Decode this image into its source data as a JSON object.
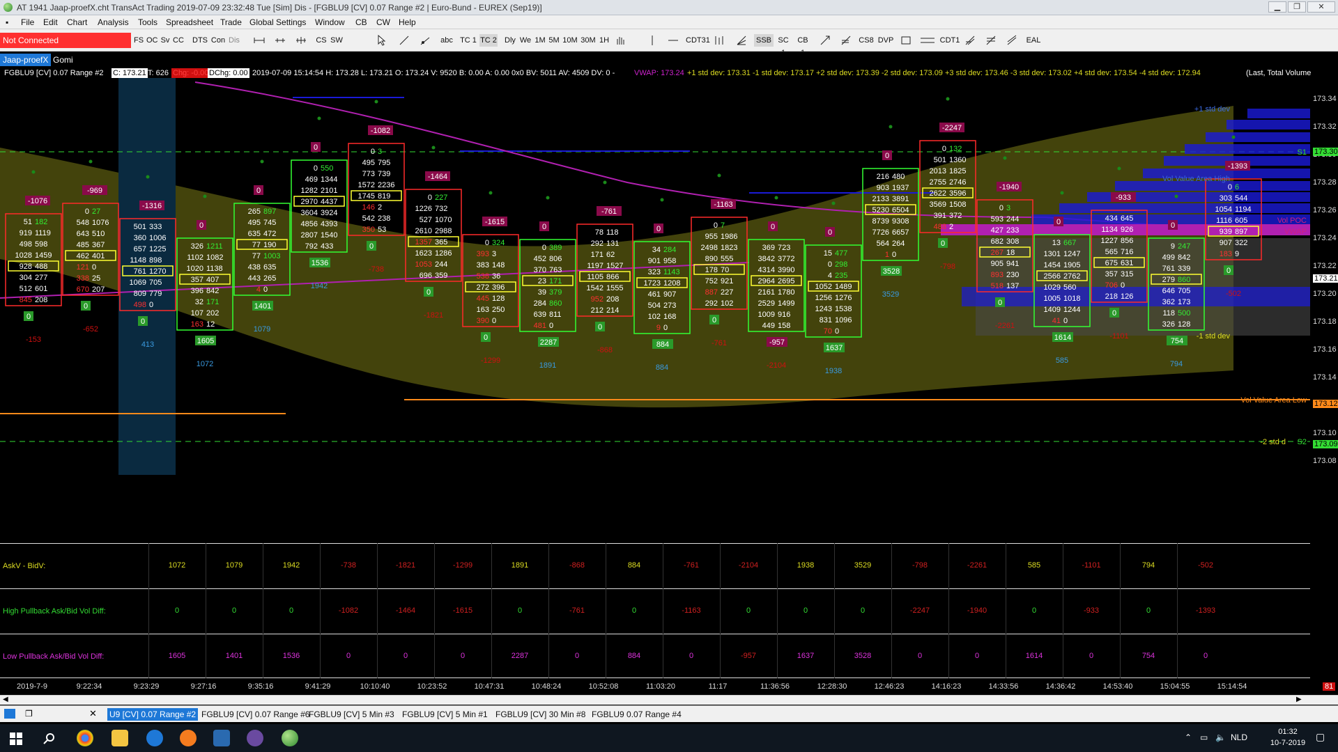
{
  "window": {
    "title": "AT 1941 Jaap-proefX.cht  TransAct Trading 2019-07-09 23:32:48 Tue [Sim]  Dis - [FGBLU9 [CV]  0.07 Range  #2 | Euro-Bund - EUREX (Sep19)]",
    "controls": {
      "minimize": "▁",
      "restore": "❐",
      "close": "✕"
    }
  },
  "menu": [
    "File",
    "Edit",
    "Chart",
    "Analysis",
    "Tools",
    "Spreadsheet",
    "Trade",
    "Global Settings",
    "Window",
    "CB",
    "CW",
    "Help"
  ],
  "toolbar": {
    "status": "Not Connected",
    "buttons": [
      "FS",
      "OC",
      "Sv",
      "CC",
      "DTS",
      "Con",
      "Dis",
      "abc",
      "TC 1",
      "TC 2",
      "Dly",
      "We",
      "1M",
      "5M",
      "10M",
      "30M",
      "1H",
      "CDT31",
      "SSB",
      "SC 1",
      "CB 1",
      "CS8",
      "DVP",
      "CDT1",
      "EAL",
      "CS",
      "SW"
    ]
  },
  "workspace_tabs": [
    "Jaap-proefX",
    "Gomi"
  ],
  "info": {
    "symbol": "FGBLU9 [CV]  0.07 Range  #2",
    "close": "C: 173.21",
    "ticks": "T: 626",
    "chg_label": "Chg: -0.00",
    "dchg_label": "DChg: 0.00",
    "rest": "2019-07-09 15:14:54 H: 173.28 L: 173.21 O: 173.24 V: 9520 B: 0.00 A: 0.00 0x0 BV: 5011 AV: 4509 DV: 0 -",
    "vwap": "VWAP: 173.24",
    "std": "+1 std dev: 173.31  -1 std dev: 173.17  +2 std dev: 173.39  -2 std dev: 173.09  +3 std dev: 173.46  -3 std dev: 173.02  +4 std dev: 173.54  -4 std dev: 172.94",
    "tail": "(Last, Total Volume"
  },
  "price_axis": [
    "173.34",
    "173.32",
    "173.30",
    "173.28",
    "173.26",
    "173.24",
    "173.22",
    "173.20",
    "173.18",
    "173.16",
    "173.14",
    "173.12",
    "173.10",
    "173.08"
  ],
  "price_tags": {
    "s1": "173.30",
    "current": "173.21",
    "val": "173.12",
    "s2": "173.09"
  },
  "chart_labels": {
    "plus1": "+1 std dev",
    "s1": "S1",
    "vah": "Vol Value Area High",
    "vpoc": "Vol POC",
    "vwap": "VWAP",
    "minus1": "-1 std dev",
    "val": "Vol Value Area Low",
    "minus2": "-2 std d",
    "s2": "S2"
  },
  "bars": [
    {
      "top": "-1076",
      "rows": [
        [
          "51",
          "182"
        ],
        [
          "919",
          "1119"
        ],
        [
          "498",
          "598"
        ],
        [
          "1028",
          "1459"
        ],
        [
          "928",
          "488"
        ],
        [
          "304",
          "277"
        ],
        [
          "512",
          "601"
        ],
        [
          "845",
          "208"
        ]
      ],
      "bottom": "0",
      "hp": "-153"
    },
    {
      "top": "-969",
      "rows": [
        [
          "0",
          "27"
        ],
        [
          "548",
          "1076"
        ],
        [
          "643",
          "510"
        ],
        [
          "485",
          "367"
        ],
        [
          "462",
          "401"
        ],
        [
          "121",
          "0"
        ],
        [
          "338",
          "25"
        ],
        [
          "670",
          "207"
        ]
      ],
      "bottom": "0",
      "hp": "-652"
    },
    {
      "top": "-1316",
      "rows": [
        [
          "501",
          "333"
        ],
        [
          "360",
          "1006"
        ],
        [
          "657",
          "1225"
        ],
        [
          "1148",
          "898"
        ],
        [
          "761",
          "1270"
        ],
        [
          "1069",
          "705"
        ],
        [
          "809",
          "779"
        ],
        [
          "498",
          "0"
        ]
      ],
      "bottom": "0",
      "hp": "413"
    },
    {
      "top": "0",
      "rows": [
        [
          "326",
          "1211"
        ],
        [
          "1102",
          "1082"
        ],
        [
          "1020",
          "1138"
        ],
        [
          "357",
          "407"
        ],
        [
          "396",
          "842"
        ],
        [
          "32",
          "171"
        ],
        [
          "107",
          "202"
        ],
        [
          "163",
          "12"
        ]
      ],
      "bottom": "1605",
      "hp": "1072"
    },
    {
      "top": "0",
      "rows": [
        [
          "265",
          "897"
        ],
        [
          "495",
          "745"
        ],
        [
          "635",
          "472"
        ],
        [
          "77",
          "190"
        ],
        [
          "77",
          "1003"
        ],
        [
          "438",
          "635"
        ],
        [
          "443",
          "265"
        ],
        [
          "4",
          "0"
        ]
      ],
      "bottom": "1401",
      "hp": "1079"
    },
    {
      "top": "0",
      "rows": [
        [
          "0",
          "550"
        ],
        [
          "469",
          "1344"
        ],
        [
          "1282",
          "2101"
        ],
        [
          "2970",
          "4437"
        ],
        [
          "3604",
          "3924"
        ],
        [
          "4856",
          "4393"
        ],
        [
          "2807",
          "1540"
        ],
        [
          "792",
          "433"
        ]
      ],
      "bottom": "1536",
      "hp": "1942"
    },
    {
      "top": "-1082",
      "rows": [
        [
          "0",
          "3"
        ],
        [
          "495",
          "795"
        ],
        [
          "773",
          "739"
        ],
        [
          "1572",
          "2236"
        ],
        [
          "1745",
          "819"
        ],
        [
          "146",
          "2"
        ],
        [
          "542",
          "238"
        ],
        [
          "350",
          "53"
        ]
      ],
      "bottom": "0",
      "hp": "-738"
    },
    {
      "top": "-1464",
      "rows": [
        [
          "0",
          "227"
        ],
        [
          "1226",
          "732"
        ],
        [
          "527",
          "1070"
        ],
        [
          "2610",
          "2988"
        ],
        [
          "1357",
          "365"
        ],
        [
          "1623",
          "1286"
        ],
        [
          "1053",
          "244"
        ],
        [
          "696",
          "359"
        ]
      ],
      "bottom": "0",
      "hp": "-1821"
    },
    {
      "top": "-1615",
      "rows": [
        [
          "0",
          "324"
        ],
        [
          "393",
          "3"
        ],
        [
          "383",
          "148"
        ],
        [
          "538",
          "36"
        ],
        [
          "272",
          "396"
        ],
        [
          "445",
          "128"
        ],
        [
          "163",
          "250"
        ],
        [
          "390",
          "0"
        ]
      ],
      "bottom": "0",
      "hp": "-1299"
    },
    {
      "top": "0",
      "rows": [
        [
          "0",
          "389"
        ],
        [
          "452",
          "806"
        ],
        [
          "370",
          "763"
        ],
        [
          "23",
          "171"
        ],
        [
          "39",
          "379"
        ],
        [
          "284",
          "860"
        ],
        [
          "639",
          "811"
        ],
        [
          "481",
          "0"
        ]
      ],
      "bottom": "2287",
      "hp": "1891"
    },
    {
      "top": "-761",
      "rows": [
        [
          "78",
          "118"
        ],
        [
          "292",
          "131"
        ],
        [
          "171",
          "62"
        ],
        [
          "1197",
          "1527"
        ],
        [
          "1105",
          "866"
        ],
        [
          "1542",
          "1555"
        ],
        [
          "952",
          "208"
        ],
        [
          "212",
          "214"
        ]
      ],
      "bottom": "0",
      "hp": "-868"
    },
    {
      "top": "0",
      "rows": [
        [
          "34",
          "284"
        ],
        [
          "901",
          "958"
        ],
        [
          "323",
          "1143"
        ],
        [
          "1723",
          "1208"
        ],
        [
          "461",
          "907"
        ],
        [
          "504",
          "273"
        ],
        [
          "102",
          "168"
        ],
        [
          "9",
          "0"
        ]
      ],
      "bottom": "884",
      "hp": "884"
    },
    {
      "top": "-1163",
      "rows": [
        [
          "0",
          "7"
        ],
        [
          "955",
          "1986"
        ],
        [
          "2498",
          "1823"
        ],
        [
          "890",
          "555"
        ],
        [
          "178",
          "70"
        ],
        [
          "752",
          "921"
        ],
        [
          "887",
          "227"
        ],
        [
          "292",
          "102"
        ]
      ],
      "bottom": "0",
      "hp": "-761"
    },
    {
      "top": "0",
      "rows": [
        [
          "369",
          "723"
        ],
        [
          "3842",
          "3772"
        ],
        [
          "4314",
          "3990"
        ],
        [
          "2964",
          "2695"
        ],
        [
          "2161",
          "1780"
        ],
        [
          "2529",
          "1499"
        ],
        [
          "1009",
          "916"
        ],
        [
          "449",
          "158"
        ]
      ],
      "bottom": "-957",
      "hp": "-2104"
    },
    {
      "top": "0",
      "rows": [
        [
          "15",
          "477"
        ],
        [
          "0",
          "298"
        ],
        [
          "4",
          "235"
        ],
        [
          "1052",
          "1489"
        ],
        [
          "1256",
          "1276"
        ],
        [
          "1243",
          "1538"
        ],
        [
          "831",
          "1096"
        ],
        [
          "70",
          "0"
        ]
      ],
      "bottom": "1637",
      "hp": "1938"
    },
    {
      "top": "0",
      "rows": [
        [
          "216",
          "480"
        ],
        [
          "903",
          "1937"
        ],
        [
          "2133",
          "3891"
        ],
        [
          "5230",
          "6504"
        ],
        [
          "8739",
          "9308"
        ],
        [
          "7726",
          "6657"
        ],
        [
          "564",
          "264"
        ],
        [
          "1",
          "0"
        ]
      ],
      "bottom": "3528",
      "hp": "3529"
    },
    {
      "top": "-2247",
      "rows": [
        [
          "0",
          "132"
        ],
        [
          "501",
          "1360"
        ],
        [
          "2013",
          "1825"
        ],
        [
          "2755",
          "2746"
        ],
        [
          "2622",
          "3596"
        ],
        [
          "3569",
          "1508"
        ],
        [
          "391",
          "372"
        ],
        [
          "488",
          "2"
        ]
      ],
      "bottom": "0",
      "hp": "-798"
    },
    {
      "top": "-1940",
      "rows": [
        [
          "0",
          "3"
        ],
        [
          "593",
          "244"
        ],
        [
          "427",
          "233"
        ],
        [
          "682",
          "308"
        ],
        [
          "267",
          "18"
        ],
        [
          "905",
          "941"
        ],
        [
          "893",
          "230"
        ],
        [
          "518",
          "137"
        ]
      ],
      "bottom": "0",
      "hp": "-2261"
    },
    {
      "top": "0",
      "rows": [
        [
          "13",
          "667"
        ],
        [
          "1301",
          "1247"
        ],
        [
          "1454",
          "1905"
        ],
        [
          "2566",
          "2762"
        ],
        [
          "1029",
          "560"
        ],
        [
          "1005",
          "1018"
        ],
        [
          "1409",
          "1244"
        ],
        [
          "41",
          "0"
        ]
      ],
      "bottom": "1614",
      "hp": "585"
    },
    {
      "top": "-933",
      "rows": [
        [
          "434",
          "645"
        ],
        [
          "1134",
          "926"
        ],
        [
          "1227",
          "856"
        ],
        [
          "565",
          "716"
        ],
        [
          "675",
          "631"
        ],
        [
          "357",
          "315"
        ],
        [
          "706",
          "0"
        ],
        [
          "218",
          "126"
        ]
      ],
      "bottom": "0",
      "hp": "-1101"
    },
    {
      "top": "0",
      "rows": [
        [
          "9",
          "247"
        ],
        [
          "499",
          "842"
        ],
        [
          "761",
          "339"
        ],
        [
          "279",
          "860"
        ],
        [
          "646",
          "705"
        ],
        [
          "362",
          "173"
        ],
        [
          "118",
          "500"
        ],
        [
          "326",
          "128"
        ]
      ],
      "bottom": "754",
      "hp": "794"
    },
    {
      "top": "-1393",
      "rows": [
        [
          "0",
          "6"
        ],
        [
          "303",
          "544"
        ],
        [
          "1054",
          "1194"
        ],
        [
          "1116",
          "605"
        ],
        [
          "939",
          "897"
        ],
        [
          "907",
          "322"
        ],
        [
          "183",
          "9"
        ]
      ],
      "bottom": "0",
      "hp": "-502"
    }
  ],
  "indicators": {
    "row1": {
      "label": "AskV - BidV:",
      "values": [
        "1072",
        "1079",
        "1942",
        "-738",
        "-1821",
        "-1299",
        "1891",
        "-868",
        "884",
        "-761",
        "-2104",
        "1938",
        "3529",
        "-798",
        "-2261",
        "585",
        "-1101",
        "794",
        "-502"
      ]
    },
    "row2": {
      "label": "High Pullback Ask/Bid Vol Diff:",
      "values": [
        "0",
        "0",
        "0",
        "-1082",
        "-1464",
        "-1615",
        "0",
        "-761",
        "0",
        "-1163",
        "0",
        "0",
        "0",
        "-2247",
        "-1940",
        "0",
        "-933",
        "0",
        "-1393"
      ]
    },
    "row3": {
      "label": "Low Pullback Ask/Bid Vol Diff:",
      "values": [
        "1605",
        "1401",
        "1536",
        "0",
        "0",
        "0",
        "2287",
        "0",
        "884",
        "0",
        "-957",
        "1637",
        "3528",
        "0",
        "0",
        "1614",
        "0",
        "754",
        "0"
      ]
    }
  },
  "time_axis": [
    "2019-7-9",
    "9:22:34",
    "9:23:29",
    "9:27:16",
    "9:35:16",
    "9:41:29",
    "10:10:40",
    "10:23:52",
    "10:47:31",
    "10:48:24",
    "10:52:08",
    "11:03:20",
    "11:17",
    "11:36:56",
    "12:28:30",
    "12:46:23",
    "14:16:23",
    "14:33:56",
    "14:36:42",
    "14:53:40",
    "15:04:55",
    "15:14:54"
  ],
  "corner_badge": "81",
  "chart_tabs": [
    "U9 [CV]  0.07 Range  #2",
    "FGBLU9 [CV]  0.07 Range  #6",
    "FGBLU9 [CV]  5 Min  #3",
    "FGBLU9 [CV]  5 Min  #1",
    "FGBLU9 [CV]  30 Min  #8",
    "FGBLU9  0.07 Range  #4"
  ],
  "taskbar": {
    "lang": "NLD",
    "time": "01:32",
    "date": "10-7-2019"
  },
  "colors": {
    "ask_color": "#ffffff",
    "bid_color": "#ffffff",
    "pos_delta": "#2a9a2a",
    "neg_delta": "#8a0a4a",
    "up_box": "#33ff33",
    "down_box": "#ff2a2a",
    "poc_box": "#ffff33",
    "band": "#5a5a10",
    "vwap": "#cc22cc"
  }
}
